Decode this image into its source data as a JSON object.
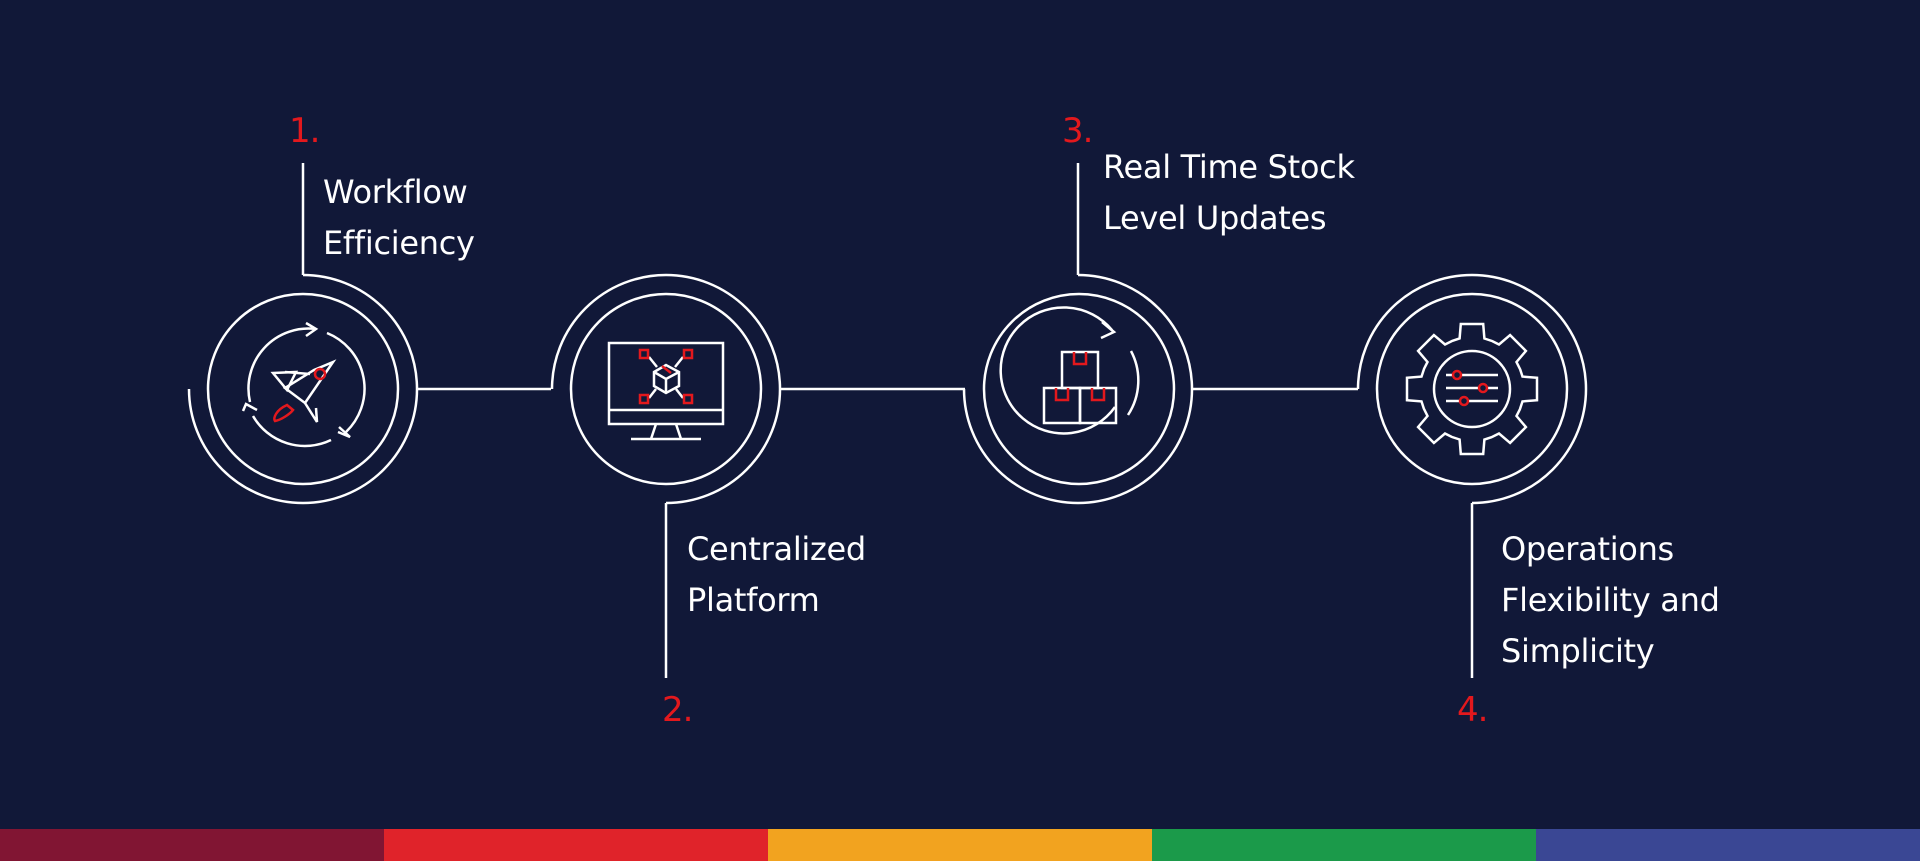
{
  "steps": [
    {
      "number": "1.",
      "lines": [
        "Workflow",
        "Efficiency"
      ],
      "icon": "rocket-cycle-icon"
    },
    {
      "number": "2.",
      "lines": [
        "Centralized",
        "Platform"
      ],
      "icon": "monitor-network-icon"
    },
    {
      "number": "3.",
      "lines": [
        "Real Time Stock",
        "Level Updates"
      ],
      "icon": "stock-boxes-icon"
    },
    {
      "number": "4.",
      "lines": [
        "Operations",
        "Flexibility and",
        "Simplicity"
      ],
      "icon": "gear-settings-icon"
    }
  ],
  "colors": {
    "background": "#111838",
    "line": "#ffffff",
    "accent": "#e3181d"
  },
  "footer_bar": {
    "colors": [
      "#811533",
      "#e0232a",
      "#f2a31f",
      "#1b9a4a",
      "#3a4794"
    ]
  }
}
